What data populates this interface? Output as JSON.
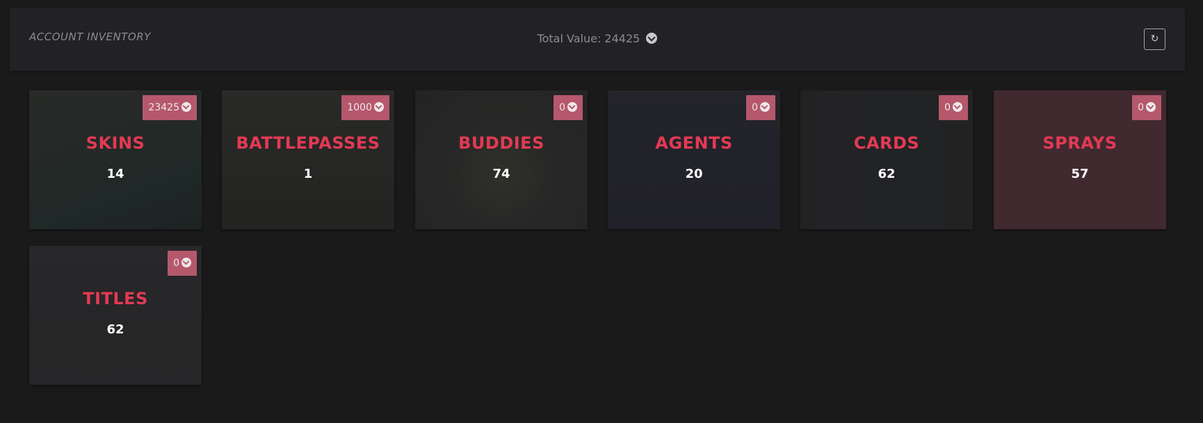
{
  "header": {
    "title": "ACCOUNT INVENTORY",
    "total_label": "Total Value: 24425",
    "currency_icon": "vp-icon",
    "refresh_icon": "refresh-icon"
  },
  "colors": {
    "background": "#1b1a1b",
    "panel": "#222123",
    "accent": "#e23a54",
    "badge": "#b5586c"
  },
  "categories": [
    {
      "name": "SKINS",
      "count": "14",
      "value": "23425"
    },
    {
      "name": "BATTLEPASSES",
      "count": "1",
      "value": "1000"
    },
    {
      "name": "BUDDIES",
      "count": "74",
      "value": "0"
    },
    {
      "name": "AGENTS",
      "count": "20",
      "value": "0"
    },
    {
      "name": "CARDS",
      "count": "62",
      "value": "0"
    },
    {
      "name": "SPRAYS",
      "count": "57",
      "value": "0"
    },
    {
      "name": "TITLES",
      "count": "62",
      "value": "0"
    }
  ]
}
